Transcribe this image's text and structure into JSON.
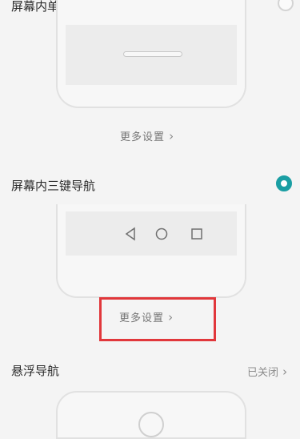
{
  "options": [
    {
      "title": "屏幕内单键导航",
      "selected": false,
      "more_label": "更多设置"
    },
    {
      "title": "屏幕内三键导航",
      "selected": true,
      "more_label": "更多设置"
    },
    {
      "title": "悬浮导航",
      "status": "已关闭"
    }
  ],
  "colors": {
    "accent": "#1a9ea3",
    "highlight": "#e1373b"
  },
  "icons": {
    "chevron": "›"
  }
}
